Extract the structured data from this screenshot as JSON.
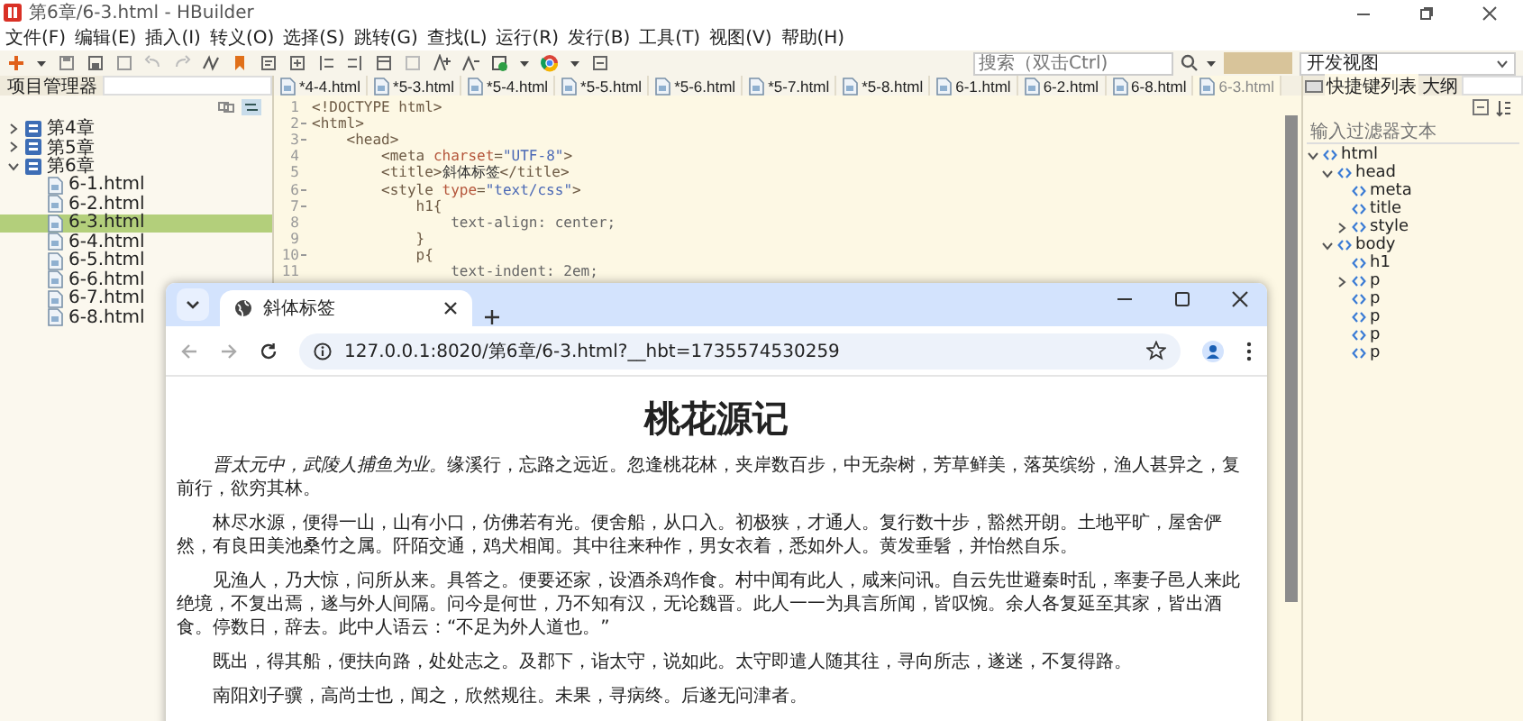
{
  "window": {
    "title": "第6章/6-3.html - HBuilder"
  },
  "menu": [
    "文件(F)",
    "编辑(E)",
    "插入(I)",
    "转义(O)",
    "选择(S)",
    "跳转(G)",
    "查找(L)",
    "运行(R)",
    "发行(B)",
    "工具(T)",
    "视图(V)",
    "帮助(H)"
  ],
  "search": {
    "placeholder": "搜索（双击Ctrl)"
  },
  "perspective": {
    "label": "开发视图"
  },
  "project_panel": {
    "title": "项目管理器",
    "tree": [
      {
        "label": "第4章",
        "expanded": false,
        "selected": false
      },
      {
        "label": "第5章",
        "expanded": false,
        "selected": false
      },
      {
        "label": "第6章",
        "expanded": true,
        "selected": false,
        "children": [
          {
            "label": "6-1.html",
            "selected": false
          },
          {
            "label": "6-2.html",
            "selected": false
          },
          {
            "label": "6-3.html",
            "selected": true
          },
          {
            "label": "6-4.html",
            "selected": false
          },
          {
            "label": "6-5.html",
            "selected": false
          },
          {
            "label": "6-6.html",
            "selected": false
          },
          {
            "label": "6-7.html",
            "selected": false
          },
          {
            "label": "6-8.html",
            "selected": false
          }
        ]
      }
    ]
  },
  "editor": {
    "tabs": [
      {
        "label": "*4-4.html",
        "selected": false
      },
      {
        "label": "*5-3.html",
        "selected": false
      },
      {
        "label": "*5-4.html",
        "selected": false
      },
      {
        "label": "*5-5.html",
        "selected": false
      },
      {
        "label": "*5-6.html",
        "selected": false
      },
      {
        "label": "*5-7.html",
        "selected": false
      },
      {
        "label": "*5-8.html",
        "selected": false
      },
      {
        "label": "6-1.html",
        "selected": false
      },
      {
        "label": "6-2.html",
        "selected": false
      },
      {
        "label": "6-8.html",
        "selected": false
      },
      {
        "label": "6-3.html",
        "selected": true
      }
    ],
    "lines": [
      {
        "number": "1",
        "foldable": false,
        "tokens": [
          {
            "text": "<!DOCTYPE html>",
            "kind": "tag"
          }
        ]
      },
      {
        "number": "2",
        "foldable": true,
        "tokens": [
          {
            "text": "<html>",
            "kind": "tag"
          }
        ]
      },
      {
        "number": "3",
        "foldable": true,
        "tokens": [
          {
            "text": "    <head>",
            "kind": "tag"
          }
        ]
      },
      {
        "number": "4",
        "foldable": false,
        "tokens": [
          {
            "text": "        <meta ",
            "kind": "tag"
          },
          {
            "text": "charset",
            "kind": "attr"
          },
          {
            "text": "=",
            "kind": "tag"
          },
          {
            "text": "\"UTF-8\"",
            "kind": "value"
          },
          {
            "text": ">",
            "kind": "tag"
          }
        ]
      },
      {
        "number": "5",
        "foldable": false,
        "tokens": [
          {
            "text": "        <title>",
            "kind": "tag"
          },
          {
            "text": "斜体标签",
            "kind": "text"
          },
          {
            "text": "</title>",
            "kind": "tag"
          }
        ]
      },
      {
        "number": "6",
        "foldable": true,
        "tokens": [
          {
            "text": "        <style ",
            "kind": "tag"
          },
          {
            "text": "type",
            "kind": "attr"
          },
          {
            "text": "=",
            "kind": "tag"
          },
          {
            "text": "\"text/css\"",
            "kind": "value"
          },
          {
            "text": ">",
            "kind": "tag"
          }
        ]
      },
      {
        "number": "7",
        "foldable": true,
        "tokens": [
          {
            "text": "            h1{",
            "kind": "selector"
          }
        ]
      },
      {
        "number": "8",
        "foldable": false,
        "tokens": [
          {
            "text": "                text-align: center;",
            "kind": "prop"
          }
        ]
      },
      {
        "number": "9",
        "foldable": false,
        "tokens": [
          {
            "text": "            }",
            "kind": "selector"
          }
        ]
      },
      {
        "number": "10",
        "foldable": true,
        "tokens": [
          {
            "text": "            p{",
            "kind": "selector"
          }
        ]
      },
      {
        "number": "11",
        "foldable": false,
        "tokens": [
          {
            "text": "                text-indent: 2em;",
            "kind": "prop"
          }
        ]
      }
    ]
  },
  "outline_panel": {
    "tabs": [
      {
        "label": "快捷键列表",
        "selected": true
      },
      {
        "label": "大纲",
        "selected": false
      }
    ],
    "filter": {
      "placeholder": "输入过滤器文本"
    },
    "tree": [
      {
        "label": "html",
        "expanded": true,
        "children": [
          {
            "label": "head",
            "expanded": true,
            "children": [
              {
                "label": "meta"
              },
              {
                "label": "title"
              },
              {
                "label": "style",
                "expanded": false
              }
            ]
          },
          {
            "label": "body",
            "expanded": true,
            "children": [
              {
                "label": "h1"
              },
              {
                "label": "p",
                "expanded": false
              },
              {
                "label": "p"
              },
              {
                "label": "p"
              },
              {
                "label": "p"
              },
              {
                "label": "p"
              }
            ]
          }
        ]
      }
    ]
  },
  "browser": {
    "tab": {
      "title": "斜体标签"
    },
    "url": "127.0.0.1:8020/第6章/6-3.html?__hbt=1735574530259",
    "heading": "桃花源记",
    "paragraphs": [
      {
        "italic": "晋太元中，武陵人捕鱼为业。",
        "text": "缘溪行，忘路之远近。忽逢桃花林，夹岸数百步，中无杂树，芳草鲜美，落英缤纷，渔人甚异之，复前行，欲穷其林。"
      },
      {
        "text": "林尽水源，便得一山，山有小口，仿佛若有光。便舍船，从口入。初极狭，才通人。复行数十步，豁然开朗。土地平旷，屋舍俨然，有良田美池桑竹之属。阡陌交通，鸡犬相闻。其中往来种作，男女衣着，悉如外人。黄发垂髫，并怡然自乐。"
      },
      {
        "text": "见渔人，乃大惊，问所从来。具答之。便要还家，设酒杀鸡作食。村中闻有此人，咸来问讯。自云先世避秦时乱，率妻子邑人来此绝境，不复出焉，遂与外人间隔。问今是何世，乃不知有汉，无论魏晋。此人一一为具言所闻，皆叹惋。余人各复延至其家，皆出酒食。停数日，辞去。此中人语云：“不足为外人道也。”"
      },
      {
        "text": "既出，得其船，便扶向路，处处志之。及郡下，诣太守，说如此。太守即遣人随其往，寻向所志，遂迷，不复得路。"
      },
      {
        "text": "南阳刘子骥，高尚士也，闻之，欣然规往。未果，寻病终。后遂无问津者。"
      }
    ]
  }
}
